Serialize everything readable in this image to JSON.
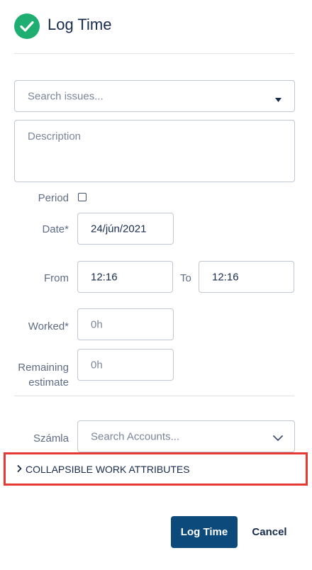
{
  "header": {
    "title": "Log Time"
  },
  "form": {
    "search_issues": {
      "placeholder": "Search issues..."
    },
    "description": {
      "placeholder": "Description"
    },
    "period": {
      "label": "Period",
      "checked": false
    },
    "date": {
      "label": "Date*",
      "value": "24/jún/2021"
    },
    "from": {
      "label": "From",
      "value": "12:16"
    },
    "to": {
      "label": "To",
      "value": "12:16"
    },
    "worked": {
      "label": "Worked*",
      "placeholder": "0h"
    },
    "remaining": {
      "label_line1": "Remaining",
      "label_line2": "estimate",
      "placeholder": "0h"
    },
    "account": {
      "label": "Számla",
      "placeholder": "Search Accounts..."
    },
    "collapsible": {
      "label": "COLLAPSIBLE WORK ATTRIBUTES"
    }
  },
  "actions": {
    "submit_label": "Log Time",
    "cancel_label": "Cancel"
  },
  "colors": {
    "accent": "#0b4a7a",
    "success": "#1fae72",
    "highlight": "#e53935"
  },
  "icons": {
    "header": "check-circle-icon",
    "search_issues": "caret-down-icon",
    "account": "chevron-down-icon",
    "collapsible": "chevron-right-icon"
  }
}
